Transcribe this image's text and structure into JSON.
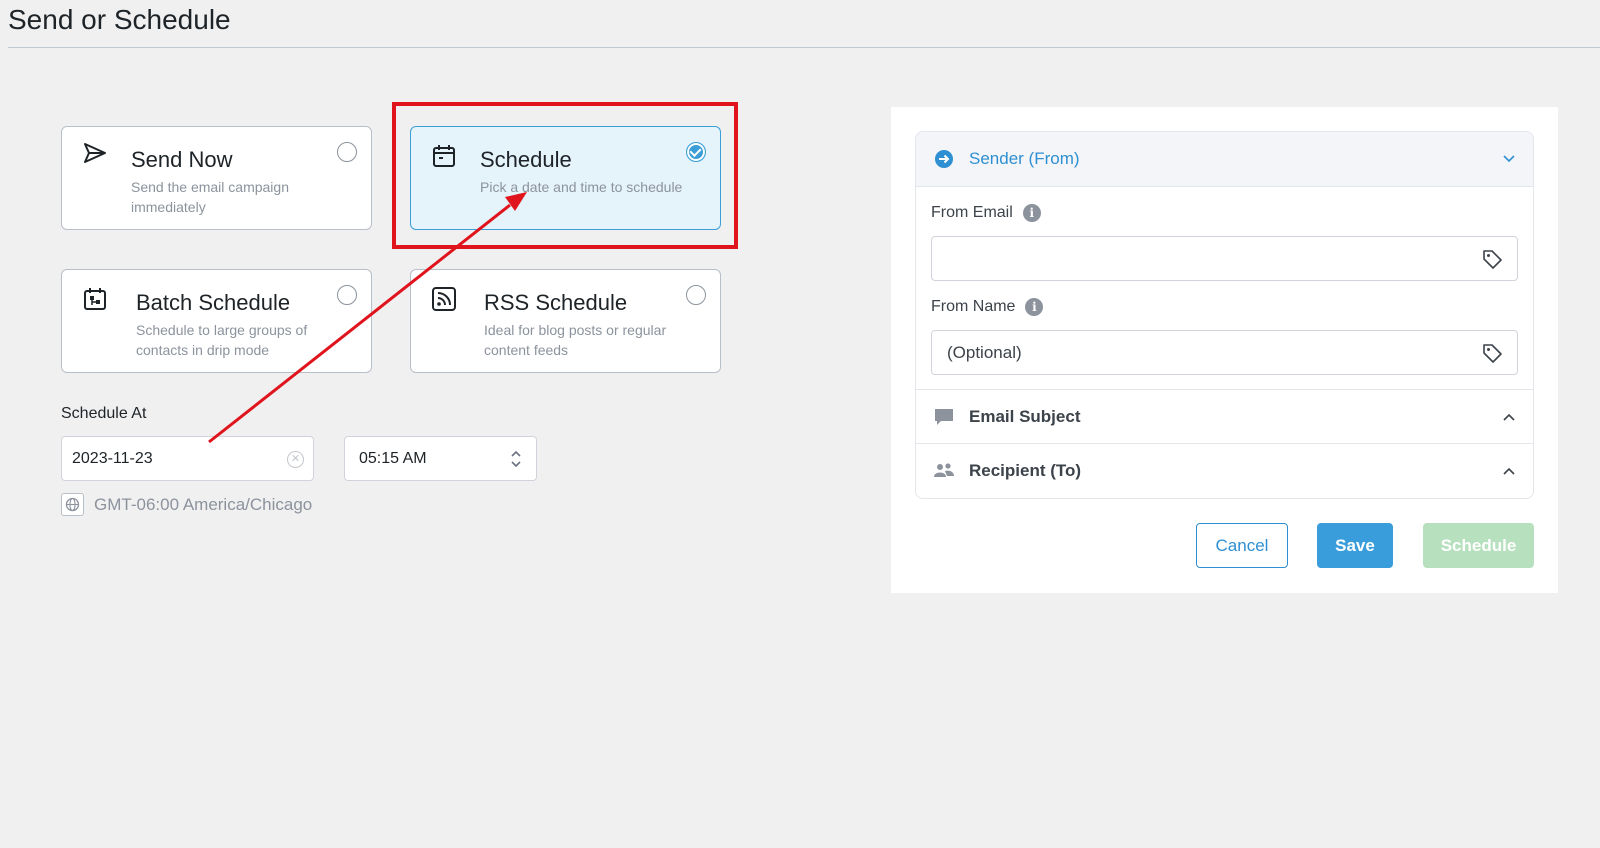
{
  "page": {
    "title": "Send or Schedule"
  },
  "options": [
    {
      "title": "Send Now",
      "desc": "Send the email campaign immediately",
      "icon": "send-icon",
      "selected": false
    },
    {
      "title": "Schedule",
      "desc": "Pick a date and time to schedule",
      "icon": "calendar-icon",
      "selected": true
    },
    {
      "title": "Batch Schedule",
      "desc": "Schedule to large groups of contacts in drip mode",
      "icon": "batch-calendar-icon",
      "selected": false
    },
    {
      "title": "RSS Schedule",
      "desc": "Ideal for blog posts or regular content feeds",
      "icon": "rss-icon",
      "selected": false
    }
  ],
  "schedule": {
    "label": "Schedule At",
    "date": "2023-11-23",
    "time": "05:15 AM",
    "timezone": "GMT-06:00 America/Chicago"
  },
  "sender": {
    "header": "Sender (From)",
    "from_email_label": "From Email",
    "from_email_value": "",
    "from_name_label": "From Name",
    "from_name_placeholder": "(Optional)"
  },
  "sections": {
    "subject": "Email Subject",
    "recipient": "Recipient (To)"
  },
  "buttons": {
    "cancel": "Cancel",
    "save": "Save",
    "schedule": "Schedule"
  },
  "colors": {
    "accent": "#3a9ddb",
    "annotation": "#e0141c",
    "schedule_disabled": "#b7e0bf"
  }
}
